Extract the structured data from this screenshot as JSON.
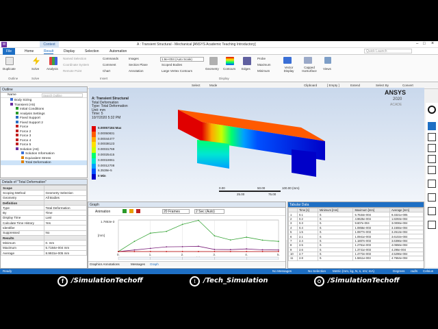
{
  "window": {
    "title": "A : Transient Structural - Mechanical [ANSYS Academic Teaching Introductory]",
    "context_tab": "Context"
  },
  "menu": {
    "file": "File",
    "home": "Home",
    "result": "Result",
    "display": "Display",
    "selection": "Selection",
    "automation": "Automation",
    "quick_launch": "Quick Launch"
  },
  "ribbon": {
    "duplicate": "Duplicate",
    "outline": "Outline",
    "solve": "Solve",
    "solve_group": "Solve",
    "analysis": "Analysis",
    "named_selection": "Named Selection",
    "coordinate_system": "Coordinate System",
    "remote_point": "Remote Point",
    "commands": "Commands",
    "comment": "Comment",
    "chart": "Chart",
    "images": "Images",
    "section_plane": "Section Plane",
    "annotation": "Annotation",
    "insert": "Insert",
    "scale_value": "1.9e+004 (Auto Scale)",
    "scoped_bodies": "Scoped Bodies",
    "large_vertex_contours": "Large Vertex Contours",
    "geometry": "Geometry",
    "contours": "Contours",
    "edges": "Edges",
    "display_group": "Display",
    "probe": "Probe",
    "maximum": "Maximum",
    "minimum": "Minimum",
    "vector_display": "Vector Display",
    "capped_isosurface": "Capped IsoSurface",
    "views": "Views"
  },
  "toolbar": {
    "select": "Select",
    "mode": "Mode",
    "clipboard": "Clipboard",
    "empty": "[ Empty ]",
    "extend": "Extend",
    "select_by": "Select By",
    "convert": "Convert"
  },
  "outline": {
    "title": "Outline",
    "search": "Search Outline",
    "name_col": "Name",
    "items": [
      "Body Sizing",
      "Transient (A5)",
      "Initial Conditions",
      "Analysis Settings",
      "Fixed Support",
      "Fixed Support 2",
      "Force",
      "Force 2",
      "Force 3",
      "Force 4",
      "Force 5",
      "Solution (A6)",
      "Solution Information",
      "Equivalent Stress",
      "Total Deformation"
    ]
  },
  "details": {
    "title": "Details of \"Total Deformation\"",
    "rows": [
      [
        "Scope",
        ""
      ],
      [
        "Scoping Method",
        "Geometry Selection"
      ],
      [
        "Geometry",
        "All Bodies"
      ],
      [
        "Definition",
        ""
      ],
      [
        "Type",
        "Total Deformation"
      ],
      [
        "By",
        "Time"
      ],
      [
        "Display Time",
        "Last"
      ],
      [
        "Calculate Time History",
        "Yes"
      ],
      [
        "Identifier",
        ""
      ],
      [
        "Suppressed",
        "No"
      ],
      [
        "Results",
        ""
      ],
      [
        "Minimum",
        "0. mm"
      ],
      [
        "Maximum",
        "5.7184e-004 mm"
      ],
      [
        "Average",
        "8.9931e-005 mm"
      ]
    ]
  },
  "viewport": {
    "title": "A: Transient Structural",
    "type1": "Total Deformation",
    "type2": "Type: Total Deformation",
    "unit": "Unit: mm",
    "time": "Time: 5",
    "date": "10/7/2020 5:32 PM",
    "legend": [
      "0.00057184 Max",
      "0.00050831",
      "0.00044477",
      "0.00038123",
      "0.00031769",
      "0.00025415",
      "0.00019061",
      "0.00012708",
      "6.3538e-5",
      "0 Min"
    ],
    "legend_colors": [
      "#e00000",
      "#ff5a00",
      "#ffaa00",
      "#ffe100",
      "#c8ff00",
      "#00ff6e",
      "#00e6d2",
      "#00a0ff",
      "#0050ff",
      "#0000c8"
    ],
    "ansys": "ANSYS",
    "ansys_year": "2020",
    "ansys_sub": "ACADE",
    "scale_labels": [
      "0.00",
      "50.00",
      "100.00 (mm)",
      "25.00",
      "75.00"
    ]
  },
  "graph": {
    "title": "Graph",
    "animation": "Animation",
    "frames": "20 Frames",
    "duration": "2 Sec (Auto)",
    "ymax_label": "1.7853e-3",
    "ylabel": "[mm]",
    "xlabel": "[s]",
    "xticks": [
      "0.",
      "1.",
      "2.",
      "3.",
      "4.",
      "5."
    ],
    "steps": [
      "1",
      "2",
      "3",
      "4",
      "5"
    ],
    "tabs": [
      "Graphics Annotations",
      "Messages",
      "Graph"
    ],
    "series": [
      {
        "name": "Maximum",
        "color": "#3aa63a",
        "values": [
          0.0,
          0.00058,
          0.00105,
          0.00115,
          0.00155,
          0.00178,
          0.0009,
          0.00066,
          0.00082,
          0.00065,
          0.00058
        ]
      },
      {
        "name": "Average",
        "color": "#7a1f7a",
        "values": [
          0.0,
          9e-05,
          0.00018,
          0.00027,
          0.00028,
          0.0003,
          0.00012,
          0.00011,
          0.00015,
          0.0001,
          9e-05
        ]
      },
      {
        "name": "Minimum",
        "color": "#c00000",
        "values": [
          0,
          0,
          0,
          0,
          0,
          0,
          0,
          0,
          0,
          0,
          0
        ]
      }
    ]
  },
  "tabular": {
    "title": "Tabular Data",
    "headers": [
      "",
      "Time [s]",
      "Minimum [mm]",
      "Maximum [mm]",
      "Average [mm]"
    ],
    "rows": [
      [
        "1",
        "0.1",
        "0.",
        "5.7634e-004",
        "9.3321e-005"
      ],
      [
        "2",
        "0.2",
        "0.",
        "4.9625e-004",
        "1.8293e-004"
      ],
      [
        "3",
        "0.3",
        "0.",
        "9.607e-004",
        "3.0006e-004"
      ],
      [
        "4",
        "0.4",
        "0.",
        "1.0856e-003",
        "3.1555e-004"
      ],
      [
        "5",
        "1.5",
        "0.",
        "1.0877e-003",
        "3.2613e-004"
      ],
      [
        "6",
        "2.1",
        "0.",
        "1.0941e-003",
        "3.6102e-004"
      ],
      [
        "7",
        "2.4",
        "0.",
        "1.1807e-003",
        "3.6396e-004"
      ],
      [
        "8",
        "2.5",
        "0.",
        "1.2751e-003",
        "4.0656e-004"
      ],
      [
        "9",
        "2.6",
        "0.",
        "1.3741e-003",
        "4.296e-004"
      ],
      [
        "10",
        "2.7",
        "0.",
        "1.4772e-003",
        "4.5296e-004"
      ],
      [
        "11",
        "2.8",
        "0.",
        "1.5811e-003",
        "4.7664e-004"
      ]
    ]
  },
  "status": {
    "ready": "Ready",
    "messages": "No Messages",
    "selection": "No Selection",
    "units": "Metric (mm, kg, N, s, mV, mA)",
    "degrees": "Degrees",
    "rads": "rad/s",
    "celsius": "Celsius"
  },
  "social": {
    "facebook": "/SimulationTechoff",
    "twitter": "/Tech_Simulation",
    "instagram": "/SimulationTechoff"
  }
}
